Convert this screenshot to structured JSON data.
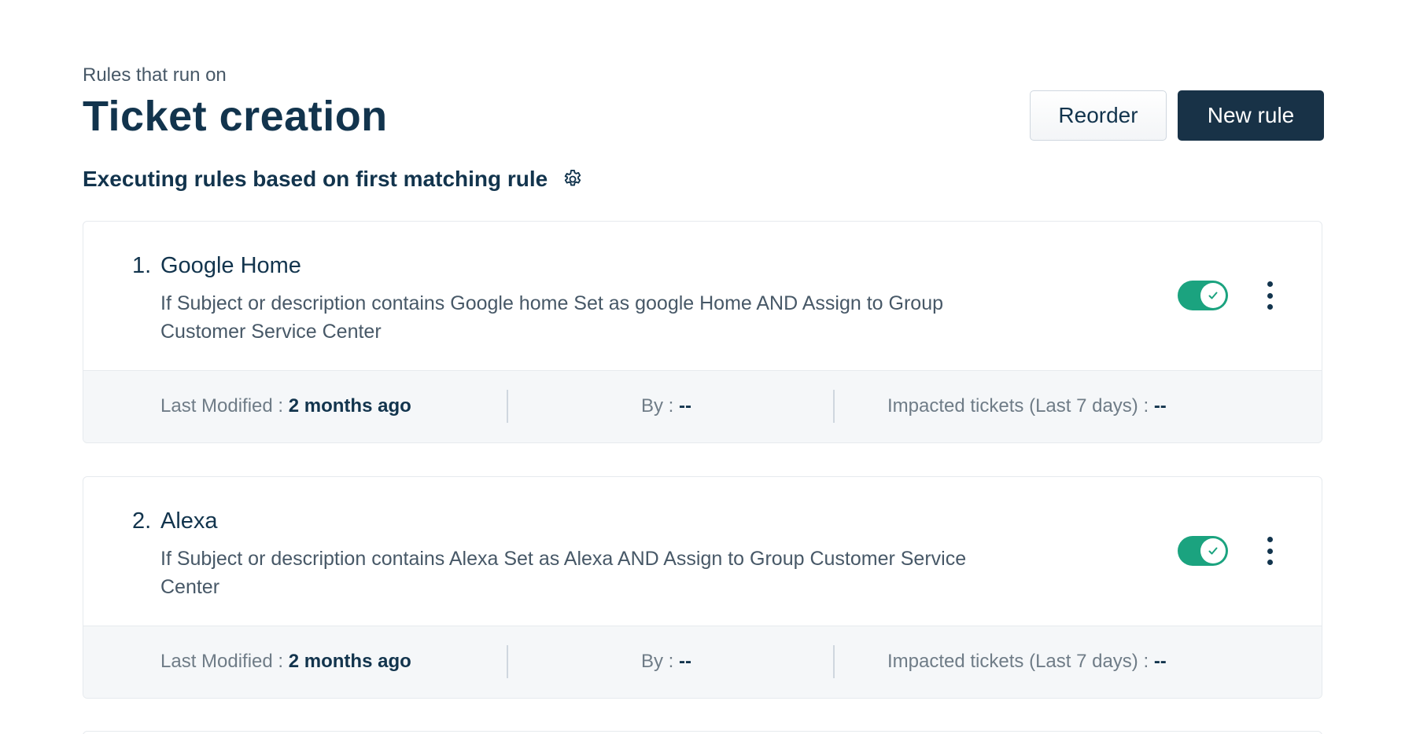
{
  "header": {
    "subtitle": "Rules that run on",
    "title": "Ticket creation"
  },
  "actions": {
    "reorder_label": "Reorder",
    "new_rule_label": "New rule"
  },
  "execution": {
    "label": "Executing rules based on first matching rule",
    "icon": "gear-icon"
  },
  "footer_labels": {
    "last_modified": "Last Modified : ",
    "by": "By : ",
    "impacted": "Impacted tickets (Last 7 days) : "
  },
  "rules": [
    {
      "number": "1.",
      "name": "Google Home",
      "description": "If Subject or description contains Google home Set as google Home AND Assign to Group Customer Service Center",
      "enabled": true,
      "last_modified": "2 months ago",
      "by": "--",
      "impacted": "--"
    },
    {
      "number": "2.",
      "name": "Alexa",
      "description": "If Subject or description contains Alexa Set as Alexa AND Assign to Group Customer Service Center",
      "enabled": true,
      "last_modified": "2 months ago",
      "by": "--",
      "impacted": "--"
    }
  ],
  "colors": {
    "primary": "#183247",
    "text": "#12344d",
    "muted": "#475867",
    "toggle_on": "#1ba37f",
    "footer_bg": "#f5f7f9",
    "border": "#e6eaee"
  }
}
